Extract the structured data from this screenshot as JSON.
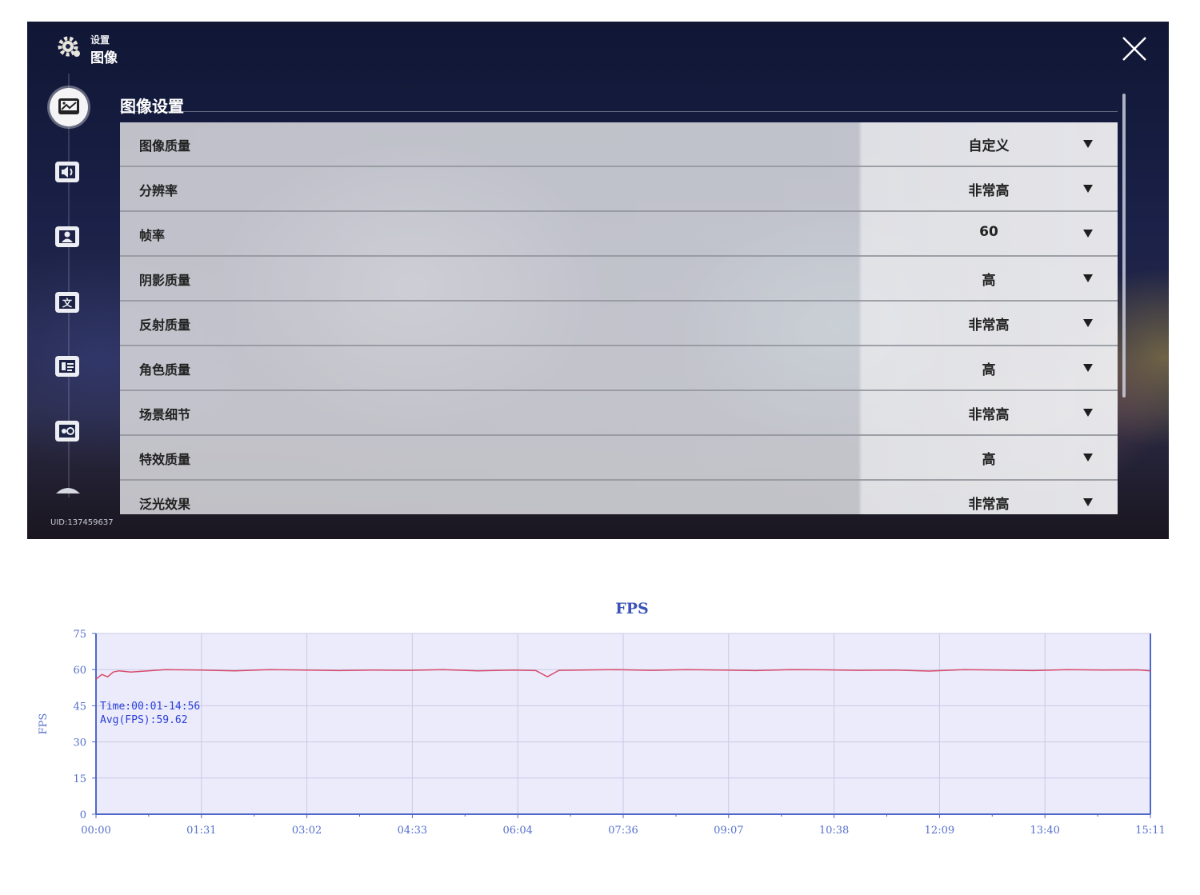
{
  "header": {
    "crumb_top": "设置",
    "crumb_main": "图像",
    "uid": "UID:137459637"
  },
  "icons": {
    "settings": "gear-icon",
    "close": "close-icon",
    "sidebar": [
      "image-settings-icon",
      "sound-icon",
      "account-icon",
      "text-icon",
      "language-icon",
      "misc-icon",
      "scroll-up-icon"
    ]
  },
  "section": {
    "title": "图像设置"
  },
  "settings": {
    "rows": [
      {
        "label": "图像质量",
        "value": "自定义"
      },
      {
        "label": "分辨率",
        "value": "非常高"
      },
      {
        "label": "帧率",
        "value": "60"
      },
      {
        "label": "阴影质量",
        "value": "高"
      },
      {
        "label": "反射质量",
        "value": "非常高"
      },
      {
        "label": "角色质量",
        "value": "高"
      },
      {
        "label": "场景细节",
        "value": "非常高"
      },
      {
        "label": "特效质量",
        "value": "高"
      },
      {
        "label": "泛光效果",
        "value": "非常高"
      }
    ]
  },
  "chart_data": {
    "type": "line",
    "title": "FPS",
    "ylabel": "FPS",
    "xlabel": "",
    "ylim": [
      0,
      75
    ],
    "yticks": [
      0,
      15,
      30,
      45,
      60,
      75
    ],
    "xticks": [
      "00:00",
      "01:31",
      "03:02",
      "04:33",
      "06:04",
      "07:36",
      "09:07",
      "10:38",
      "12:09",
      "13:40",
      "15:11"
    ],
    "grid": true,
    "annotation": [
      "Time:00:01-14:56",
      "Avg(FPS):59.62"
    ],
    "series": [
      {
        "color": "#d94a6a",
        "x": [
          0,
          5,
          10,
          15,
          20,
          30,
          45,
          60,
          90,
          120,
          150,
          180,
          210,
          240,
          270,
          300,
          330,
          360,
          380,
          390,
          400,
          420,
          450,
          480,
          510,
          540,
          570,
          600,
          630,
          660,
          690,
          720,
          750,
          780,
          810,
          840,
          870,
          900,
          911
        ],
        "values": [
          56,
          58,
          57,
          59,
          59.5,
          59,
          59.5,
          60,
          59.8,
          59.5,
          60,
          59.8,
          59.6,
          59.8,
          59.7,
          60,
          59.5,
          59.8,
          59.6,
          57,
          59.7,
          59.8,
          60,
          59.7,
          60,
          59.8,
          59.6,
          60,
          59.9,
          59.7,
          59.8,
          59.4,
          60,
          59.8,
          59.6,
          60,
          59.8,
          59.9,
          59.5
        ]
      }
    ],
    "colors": {
      "plot_bg": "#ebebfb",
      "grid": "#c9cbe4",
      "axis": "#4f67c9",
      "tick_text": "#5670cc",
      "annotation": "#2a3fd8"
    }
  }
}
